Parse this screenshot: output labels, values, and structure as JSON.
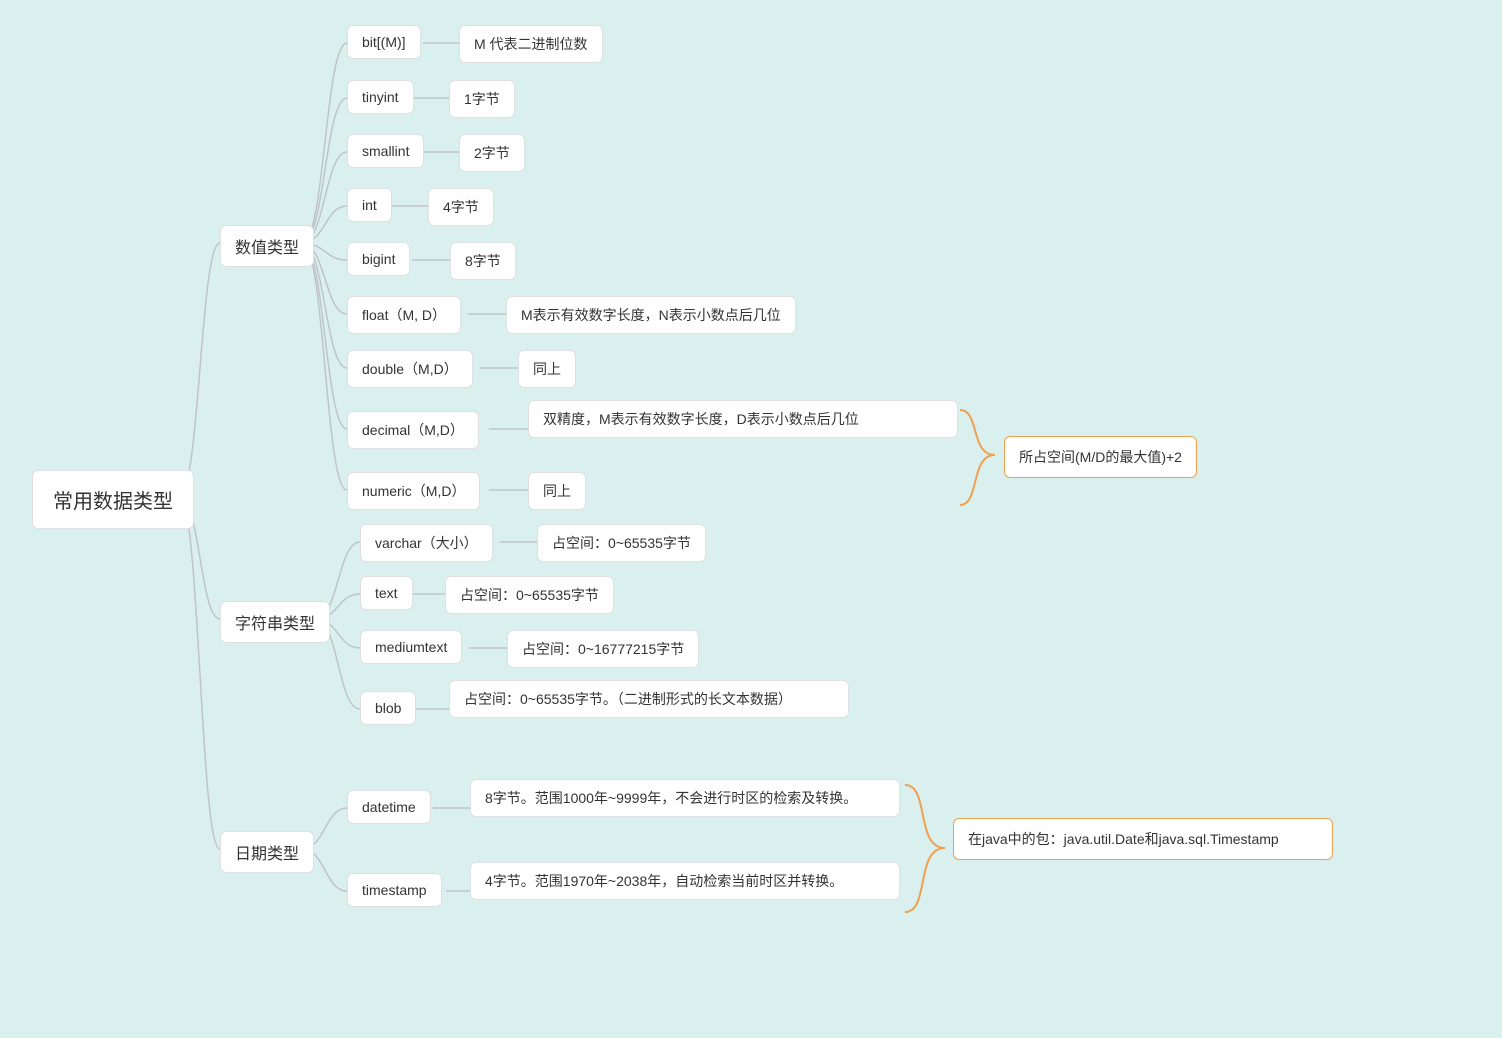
{
  "root": {
    "label": "常用数据类型"
  },
  "categories": {
    "numeric": {
      "label": "数值类型"
    },
    "string": {
      "label": "字符串类型"
    },
    "date": {
      "label": "日期类型"
    }
  },
  "numeric": {
    "bit": {
      "name": "bit[(M)]",
      "desc": "M 代表二进制位数"
    },
    "tinyint": {
      "name": "tinyint",
      "desc": "1字节"
    },
    "smallint": {
      "name": "smallint",
      "desc": "2字节"
    },
    "int": {
      "name": "int",
      "desc": "4字节"
    },
    "bigint": {
      "name": "bigint",
      "desc": "8字节"
    },
    "float": {
      "name": "float（M, D）",
      "desc": "M表示有效数字长度，N表示小数点后几位"
    },
    "double": {
      "name": "double（M,D）",
      "desc": "同上"
    },
    "decimal": {
      "name": "decimal（M,D）",
      "desc": "双精度，M表示有效数字长度，D表示小数点后几位"
    },
    "numeric": {
      "name": "numeric（M,D）",
      "desc": "同上"
    }
  },
  "string": {
    "varchar": {
      "name": "varchar（大小）",
      "desc": "占空间：0~65535字节"
    },
    "text": {
      "name": "text",
      "desc": "占空间：0~65535字节"
    },
    "mediumtext": {
      "name": "mediumtext",
      "desc": "占空间：0~16777215字节"
    },
    "blob": {
      "name": "blob",
      "desc": "占空间：0~65535字节。（二进制形式的长文本数据）"
    }
  },
  "date": {
    "datetime": {
      "name": "datetime",
      "desc": "8字节。范围1000年~9999年，不会进行时区的检索及转换。"
    },
    "timestamp": {
      "name": "timestamp",
      "desc": "4字节。范围1970年~2038年，自动检索当前时区并转换。"
    }
  },
  "annotations": {
    "decimal_space": "所占空间(M/D的最大值)+2",
    "java_packages": "在java中的包：java.util.Date和java.sql.Timestamp"
  }
}
